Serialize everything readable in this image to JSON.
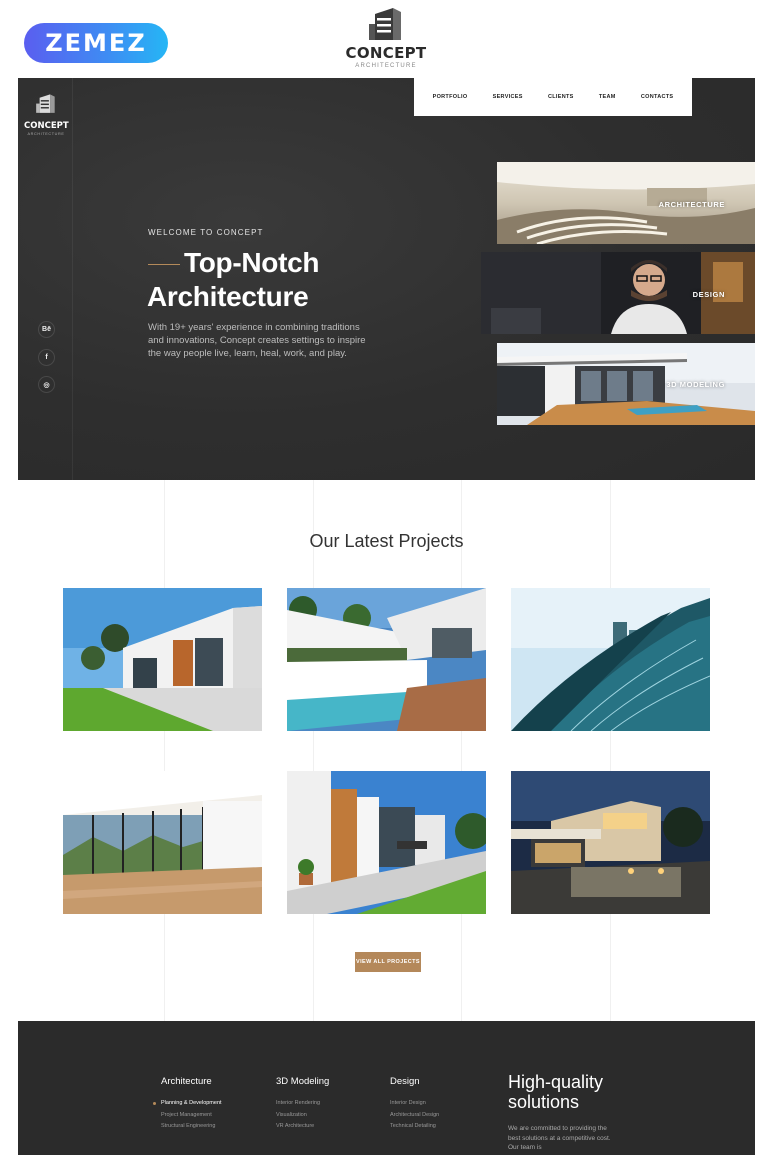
{
  "badge": {
    "brand": "ZEMEZ"
  },
  "top_logo": {
    "name": "CONCEPT",
    "sub": "ARCHITECTURE"
  },
  "hero_logo": {
    "name": "CONCEPT",
    "sub": "ARCHITECTURE"
  },
  "nav": {
    "items": [
      "PORTFOLIO",
      "SERVICES",
      "CLIENTS",
      "TEAM",
      "CONTACTS"
    ]
  },
  "social": [
    {
      "label": "Bē",
      "icon": "behance-icon"
    },
    {
      "label": "f",
      "icon": "facebook-icon"
    },
    {
      "label": "◎",
      "icon": "instagram-icon"
    }
  ],
  "hero": {
    "eyebrow": "WELCOME TO CONCEPT",
    "title_line1": "Top-Notch",
    "title_line2": "Architecture",
    "lead": "With 19+ years' experience in combining traditions and innovations, Concept creates settings to inspire the way people  live, learn, heal, work, and play."
  },
  "services": [
    "ARCHITECTURE",
    "DESIGN",
    "3D MODELING"
  ],
  "projects": {
    "title": "Our Latest Projects",
    "button": "VIEW ALL PROJECTS"
  },
  "footer": {
    "columns": [
      {
        "heading": "Architecture",
        "items": [
          "Planning & Development",
          "Project Management",
          "Structural Engineering"
        ]
      },
      {
        "heading": "3D Modeling",
        "items": [
          "Interior Rendering",
          "Visualization",
          "VR Architecture"
        ]
      },
      {
        "heading": "Design",
        "items": [
          "Interior Design",
          "Architectural Design",
          "Technical Detailing"
        ]
      }
    ],
    "tagline_line1": "High-quality",
    "tagline_line2": "solutions",
    "paragraph": "We are committed to providing the best solutions at a competitive cost. Our team is"
  },
  "colors": {
    "accent": "#b4885a",
    "dark": "#2b2b2b",
    "badge_start": "#5a5ef0",
    "badge_end": "#25b6f5"
  }
}
